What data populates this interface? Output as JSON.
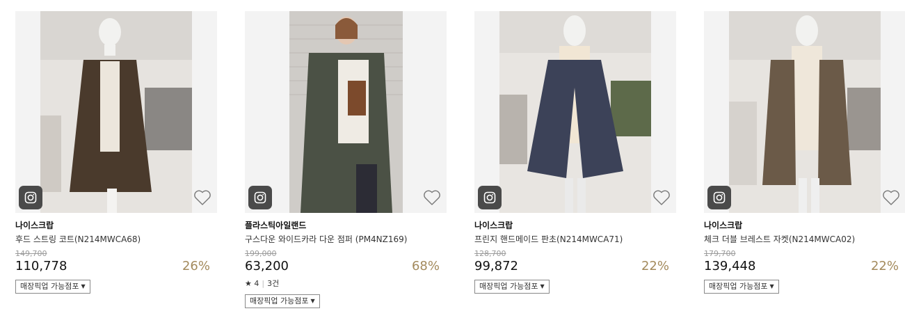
{
  "products": [
    {
      "brand": "나이스크랍",
      "name": "후드 스트링 코트(N214MWCA68)",
      "original_price": "149,700",
      "price": "110,778",
      "discount": "26%",
      "pickup_label": "매장픽업 가능점포",
      "garment_color": "#4a3a2c"
    },
    {
      "brand": "플라스틱아일랜드",
      "name": "구스다운 와이드카라 다운 점퍼 (PM4NZ169)",
      "original_price": "199,000",
      "price": "63,200",
      "discount": "68%",
      "rating": {
        "star": "★",
        "score": "4",
        "count": "3건"
      },
      "pickup_label": "매장픽업 가능점포",
      "garment_color": "#4b5145"
    },
    {
      "brand": "나이스크랍",
      "name": "프린지 핸드메이드 판초(N214MWCA71)",
      "original_price": "128,700",
      "price": "99,872",
      "discount": "22%",
      "pickup_label": "매장픽업 가능점포",
      "garment_color": "#3c4258"
    },
    {
      "brand": "나이스크랍",
      "name": "체크 더블 브레스트 자켓(N214MWCA02)",
      "original_price": "179,700",
      "price": "139,448",
      "discount": "22%",
      "pickup_label": "매장픽업 가능점포",
      "garment_color": "#6b5a48"
    }
  ]
}
